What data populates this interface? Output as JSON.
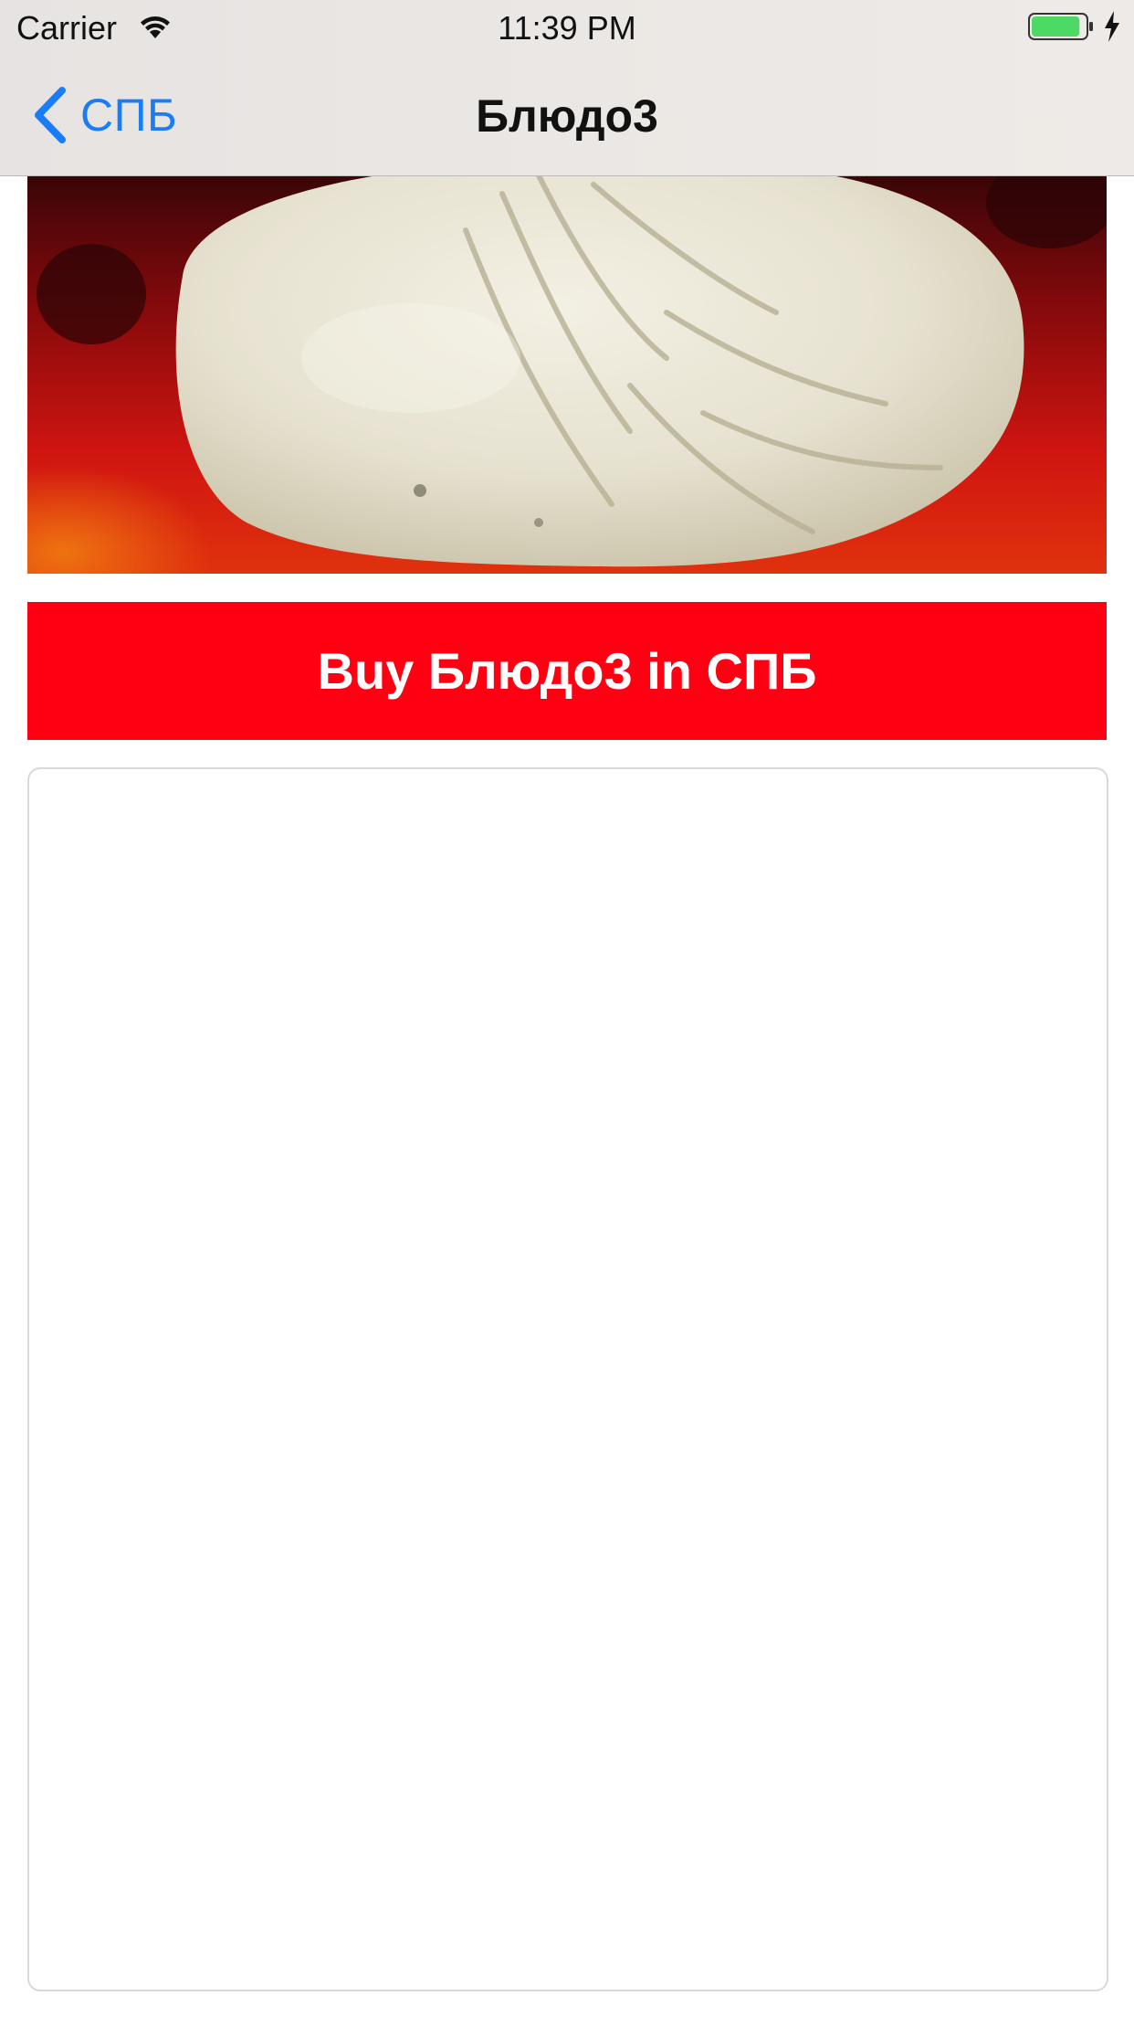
{
  "status_bar": {
    "carrier": "Carrier",
    "time": "11:39 PM",
    "wifi_icon": "wifi-icon",
    "battery_icon": "battery-icon",
    "charging_icon": "charging-bolt-icon",
    "battery_color": "#4cd964",
    "battery_level": 0.9
  },
  "nav_bar": {
    "back_label": "СПБ",
    "back_icon": "chevron-left-icon",
    "title": "Блюдо3",
    "tint_color": "#1a7cf6"
  },
  "content": {
    "dish_image": "dumpling-photo",
    "buy_button_label": "Buy Блюдо3 in СПБ",
    "buy_button_color": "#ff0013"
  }
}
